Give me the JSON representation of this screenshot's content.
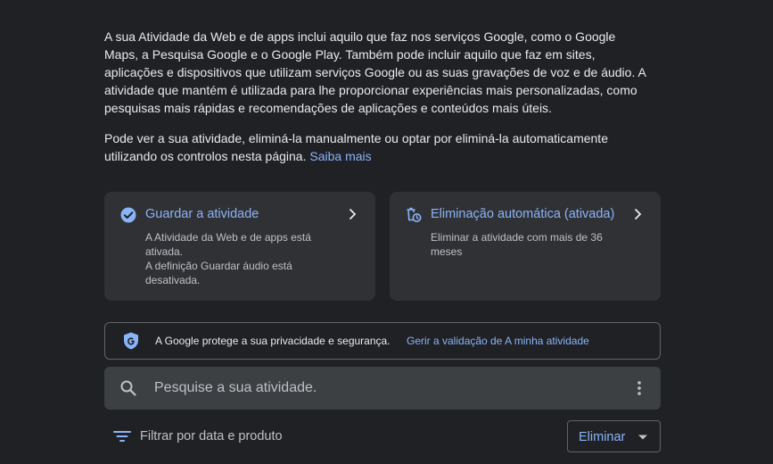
{
  "intro": {
    "paragraph1": "A sua Atividade da Web e de apps inclui aquilo que faz nos serviços Google, como o Google Maps, a Pesquisa Google e o Google Play. Também pode incluir aquilo que faz em sites, aplicações e dispositivos que utilizam serviços Google ou as suas gravações de voz e de áudio. A atividade que mantém é utilizada para lhe proporcionar experiências mais personalizadas, como pesquisas mais rápidas e recomendações de aplicações e conteúdos mais úteis.",
    "paragraph2": "Pode ver a sua atividade, eliminá-la manualmente ou optar por eliminá-la automaticamente utilizando os controlos nesta página.",
    "learn_more": "Saiba mais"
  },
  "cards": {
    "save": {
      "title": "Guardar a atividade",
      "line1": "A Atividade da Web e de apps está ativada.",
      "line2": "A definição Guardar áudio está desativada.",
      "icon": "check-circle-icon"
    },
    "auto_delete": {
      "title": "Eliminação automática (ativada)",
      "line1": "Eliminar a atividade com mais de 36 meses",
      "icon": "auto-delete-icon"
    }
  },
  "privacy": {
    "text": "A Google protege a sua privacidade e segurança.",
    "link": "Gerir a validação de A minha atividade",
    "icon": "google-shield-icon"
  },
  "search": {
    "placeholder": "Pesquise a sua atividade."
  },
  "filter": {
    "label": "Filtrar por data e produto"
  },
  "delete_button": {
    "label": "Eliminar"
  },
  "colors": {
    "background": "#202124",
    "card": "#303134",
    "accent": "#8ab4f8",
    "text": "#e8eaed",
    "muted": "#bdc1c6"
  }
}
